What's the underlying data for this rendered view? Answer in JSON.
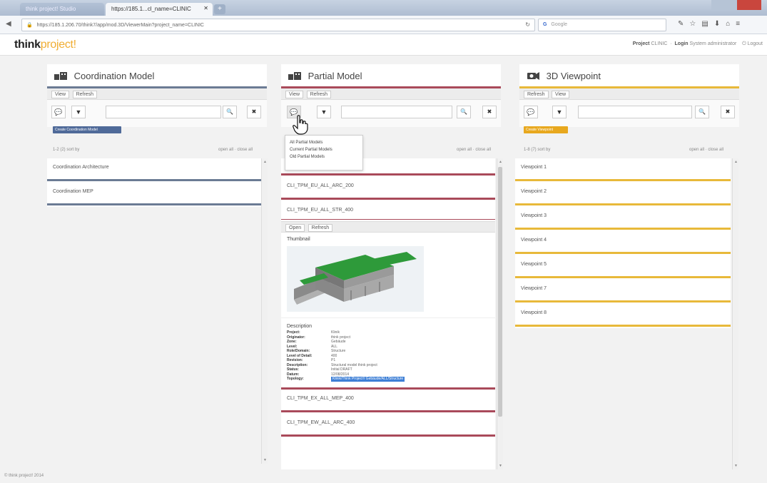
{
  "browser": {
    "tabs": [
      {
        "label": "think project! Studio",
        "active": false
      },
      {
        "label": "https://185.1...cl_name=CLINIC",
        "active": true
      }
    ],
    "url": "https://185.1.206.70/think7/app/mod.3D/ViewerMain?project_name=CLINIC",
    "search_placeholder": "Google",
    "colors": {
      "tabbar": "#b8c6d9",
      "close": "#c9463d"
    }
  },
  "app": {
    "logo_think": "think",
    "logo_project": "project!",
    "header_project_label": "Project",
    "header_project_value": "CLINIC",
    "header_login_label": "Login",
    "header_login_value": "System administrator",
    "header_logout": "Logout",
    "footer": "© think project! 2014"
  },
  "panels": {
    "coordination": {
      "title": "Coordination Model",
      "accent": "#6b7b94",
      "toolbar": [
        "View",
        "Refresh"
      ],
      "tag": "Create Coordination Model",
      "list_info": "1-2 (2) sort by",
      "open_close": "open all · close all",
      "items": [
        "Coordination Architecture",
        "Coordination MEP"
      ]
    },
    "partial": {
      "title": "Partial Model",
      "accent": "#a94a5a",
      "toolbar": [
        "View",
        "Refresh"
      ],
      "open_close": "open all · close all",
      "dropdown": [
        "All Partial Models",
        "Current Partial Models",
        "Old Partial Models"
      ],
      "items_top": [
        "CLI_TPM_EU_ALL_ARC_200",
        "CLI_TPM_EU_ALL_STR_400"
      ],
      "detail": {
        "toolbar": [
          "Open",
          "Refresh"
        ],
        "thumbnail_label": "Thumbnail",
        "description_label": "Description",
        "fields": [
          {
            "k": "Project:",
            "v": "Klinik"
          },
          {
            "k": "Originator:",
            "v": "think project"
          },
          {
            "k": "Zone:",
            "v": "Gebäude"
          },
          {
            "k": "Level:",
            "v": "ALL"
          },
          {
            "k": "Role/Domain:",
            "v": "Structure"
          },
          {
            "k": "Level of Detail:",
            "v": "400"
          },
          {
            "k": "Revision:",
            "v": "P1"
          },
          {
            "k": "Description:",
            "v": "Structural model think project"
          },
          {
            "k": "Status:",
            "v": "Initial DRAFT"
          },
          {
            "k": "Datum:",
            "v": "12/08/2014"
          },
          {
            "k": "Topology:",
            "v": "Klinik/Think Project!/ Gebäude/ALL/Structure",
            "selected": true
          }
        ]
      },
      "items_bottom": [
        "CLI_TPM_EX_ALL_MEP_400",
        "CLI_TPM_EW_ALL_ARC_400"
      ]
    },
    "viewpoint": {
      "title": "3D Viewpoint",
      "accent": "#e8b93a",
      "toolbar": [
        "Refresh",
        "View"
      ],
      "tag": "Create Viewpoint",
      "list_info": "1-8 (7) sort by",
      "open_close": "open all · close all",
      "items": [
        "Viewpoint 1",
        "Viewpoint 2",
        "Viewpoint 3",
        "Viewpoint 4",
        "Viewpoint 5",
        "Viewpoint 7",
        "Viewpoint 8"
      ]
    }
  },
  "icons": {
    "comment": "comment-icon",
    "filter": "filter-icon",
    "search": "search-icon",
    "clear": "clear-icon"
  }
}
